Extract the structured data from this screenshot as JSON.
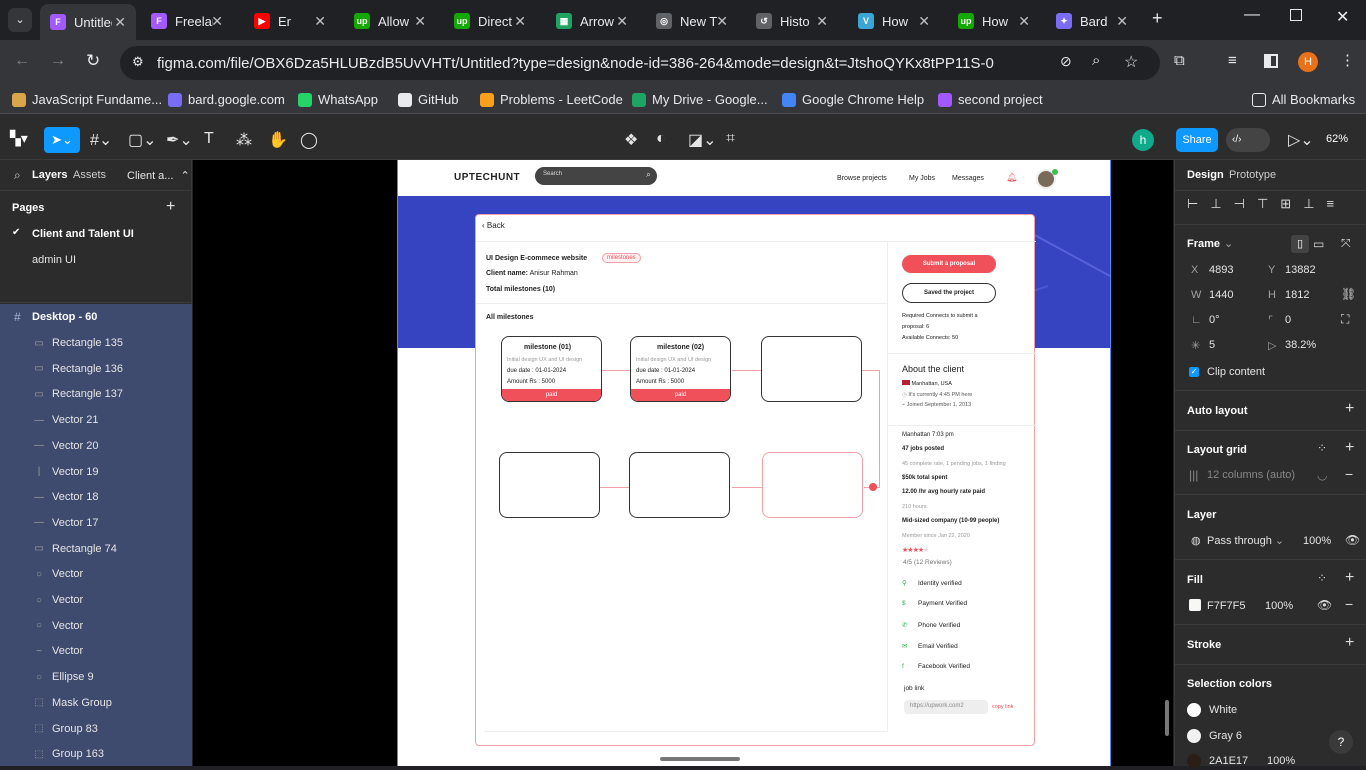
{
  "browser": {
    "tabs": [
      {
        "title": "Untitled",
        "color": "#a259ff",
        "glyph": "F"
      },
      {
        "title": "Freelance",
        "color": "#a259ff",
        "glyph": "F"
      },
      {
        "title": "Er",
        "color": "#ff0000",
        "glyph": "▶"
      },
      {
        "title": "Allow",
        "color": "#14a800",
        "glyph": "up"
      },
      {
        "title": "Direct",
        "color": "#14a800",
        "glyph": "up"
      },
      {
        "title": "Arrow",
        "color": "#1ea362",
        "glyph": "▦"
      },
      {
        "title": "New T",
        "color": "#5f6368",
        "glyph": "◎"
      },
      {
        "title": "Histo",
        "color": "#5f6368",
        "glyph": "↺"
      },
      {
        "title": "How",
        "color": "#3ba5d6",
        "glyph": "V"
      },
      {
        "title": "How",
        "color": "#14a800",
        "glyph": "up"
      },
      {
        "title": "Bard",
        "color": "#7b6cf6",
        "glyph": "✦"
      }
    ],
    "url": "figma.com/file/OBX6Dza5HLUBzdB5UvVHTt/Untitled?type=design&node-id=386-264&mode=design&t=JtshoQYKx8tPP11S-0",
    "profile_initial": "H",
    "bookmarks": [
      {
        "label": "JavaScript Fundame...",
        "color": "#d9a64a"
      },
      {
        "label": "bard.google.com",
        "color": "#7b6cf6"
      },
      {
        "label": "WhatsApp",
        "color": "#25d366"
      },
      {
        "label": "GitHub",
        "color": "#e8eaed"
      },
      {
        "label": "Problems - LeetCode",
        "color": "#f89f1b"
      },
      {
        "label": "My Drive - Google...",
        "color": "#1fa463"
      },
      {
        "label": "Google Chrome Help",
        "color": "#4285f4"
      },
      {
        "label": "second project",
        "color": "#a259ff"
      }
    ],
    "all_bookmarks": "All Bookmarks"
  },
  "figma": {
    "share_label": "Share",
    "zoom": "62%",
    "avatar_initial": "h",
    "left": {
      "tab_layers": "Layers",
      "tab_assets": "Assets",
      "page_dropdown": "Client a...",
      "pages_heading": "Pages",
      "pages": [
        "Client and Talent  UI",
        "admin UI"
      ],
      "selected_frame": "Desktop - 60",
      "layers": [
        {
          "name": "Rectangle 135",
          "icon": "▭"
        },
        {
          "name": "Rectangle 136",
          "icon": "▭"
        },
        {
          "name": "Rectangle 137",
          "icon": "▭"
        },
        {
          "name": "Vector 21",
          "icon": "—"
        },
        {
          "name": "Vector 20",
          "icon": "—"
        },
        {
          "name": "Vector 19",
          "icon": "|"
        },
        {
          "name": "Vector 18",
          "icon": "—"
        },
        {
          "name": "Vector 17",
          "icon": "—"
        },
        {
          "name": "Rectangle 74",
          "icon": "▭"
        },
        {
          "name": "Vector",
          "icon": "○"
        },
        {
          "name": "Vector",
          "icon": "○"
        },
        {
          "name": "Vector",
          "icon": "○"
        },
        {
          "name": "Vector",
          "icon": "~"
        },
        {
          "name": "Ellipse 9",
          "icon": "○"
        },
        {
          "name": "Mask Group",
          "icon": "⬚"
        },
        {
          "name": "Group 83",
          "icon": "⬚"
        },
        {
          "name": "Group 163",
          "icon": "⬚"
        }
      ]
    },
    "right": {
      "tab_design": "Design",
      "tab_prototype": "Prototype",
      "frame_label": "Frame",
      "x_label": "X",
      "x": "4893",
      "y_label": "Y",
      "y": "13882",
      "w_label": "W",
      "w": "1440",
      "h_label": "H",
      "h": "1812",
      "rotation": "0°",
      "radius": "0",
      "corner_smoothing": "5",
      "percent": "38.2%",
      "clip_content": "Clip content",
      "auto_layout": "Auto layout",
      "layout_grid": "Layout grid",
      "grid_desc": "12 columns (auto)",
      "layer": "Layer",
      "pass_through": "Pass through",
      "layer_opacity": "100%",
      "fill": "Fill",
      "fill_hex": "F7F7F5",
      "fill_opacity": "100%",
      "stroke": "Stroke",
      "selection_colors": "Selection colors",
      "colors": [
        {
          "name": "White",
          "swatch": "#ffffff"
        },
        {
          "name": "Gray 6",
          "swatch": "#f2f2f2"
        },
        {
          "name": "2A1E17",
          "swatch": "#2a1e17",
          "opacity": "100%"
        }
      ],
      "help": "?"
    }
  },
  "design": {
    "logo": "UPTECHUNT",
    "search_placeholder": "Search",
    "nav_links": [
      "Browse projects",
      "My Jobs",
      "Messages"
    ],
    "back": "Back",
    "project_title": "UI Design E-commece website",
    "tag": "milestones",
    "client_name_label": "Client name:",
    "client_name": "Anisur Rahman",
    "total_milestones": "Total milestones (10)",
    "all_milestones": "All milestones",
    "milestones": [
      {
        "title": "milestone (01)",
        "desc": "Initial design UX and UI design",
        "due": "due date  : 01-01-2024",
        "amount": "Amount   Rs : 5000",
        "status": "paid"
      },
      {
        "title": "milestone (02)",
        "desc": "Initial design UX and UI design",
        "due": "due date  : 01-01-2024",
        "amount": "Amount   Rs : 5000",
        "status": "paid"
      }
    ],
    "submit_proposal": "Submit a proposal",
    "saved_project": "Saved the project",
    "connects_required": "Required Connects to submit a",
    "connects_required_2": "proposal: 6",
    "connects_available": "Available Connects: 50",
    "about_client": "About the client",
    "location": "Manhattan, USA",
    "local_time": "It's currently 4:45 PM here",
    "joined": "Joined September 1, 2013",
    "city_time": "Manhattan 7:03 pm",
    "jobs_posted": "47 jobs posted",
    "jobs_detail": "45 complete rate, 1 pending jobs, 1 finding",
    "total_spent": "$50k total spent",
    "hourly_rate": "12.00 /hr avg hourly rate paid",
    "hours": "210 hours",
    "company": "Mid-sized company (10-99 people)",
    "member_since": "Member since Jan 22, 2020",
    "rating": 4,
    "rating_max": 5,
    "reviews": "4/5  (12 Reviews)",
    "verifications": [
      {
        "label": "Identity verified",
        "icon": "user-icon"
      },
      {
        "label": "Payment Verified",
        "icon": "dollar-icon"
      },
      {
        "label": "Phone Verified",
        "icon": "phone-icon"
      },
      {
        "label": "Email Verified",
        "icon": "mail-icon"
      },
      {
        "label": "Facebook Verified",
        "icon": "facebook-icon"
      }
    ],
    "job_link_label": "job link",
    "job_link": "https://upwork.com2",
    "copy_link": "copy link"
  }
}
